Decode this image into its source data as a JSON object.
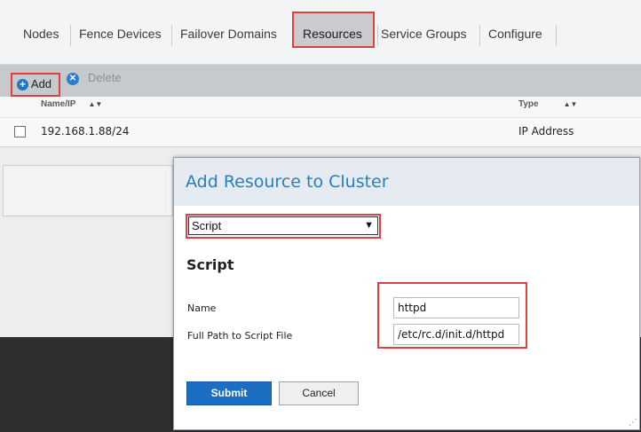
{
  "tabs": [
    {
      "label": "Nodes"
    },
    {
      "label": "Fence Devices"
    },
    {
      "label": "Failover Domains"
    },
    {
      "label": "Resources"
    },
    {
      "label": "Service Groups"
    },
    {
      "label": "Configure"
    }
  ],
  "active_tab": "Resources",
  "toolbar": {
    "add_label": "Add",
    "delete_label": "Delete"
  },
  "table": {
    "columns": [
      "Name/IP",
      "Type"
    ],
    "rows": [
      {
        "name_ip": "192.168.1.88/24",
        "type": "IP Address"
      }
    ]
  },
  "dialog": {
    "title": "Add Resource to Cluster",
    "resource_type_selected": "Script",
    "section_title": "Script",
    "fields": [
      {
        "label": "Name",
        "value": "httpd"
      },
      {
        "label": "Full Path to Script File",
        "value": "/etc/rc.d/init.d/httpd"
      }
    ],
    "submit_label": "Submit",
    "cancel_label": "Cancel"
  },
  "colors": {
    "accent": "#2680b9",
    "highlight": "#e04040",
    "submit": "#1c6ec2"
  },
  "icons": {
    "add": "plus-circle-icon",
    "delete": "x-circle-icon",
    "sort": "sort-icon",
    "select": "chevron-down-icon"
  }
}
